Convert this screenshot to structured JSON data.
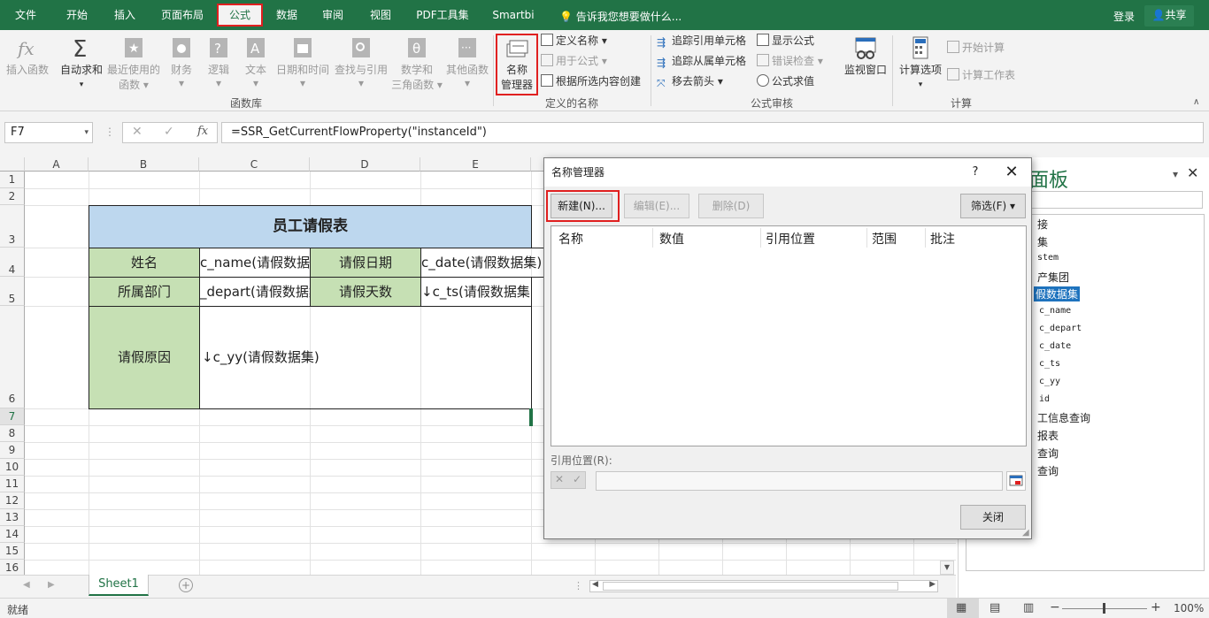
{
  "menu": {
    "tabs": [
      "文件",
      "开始",
      "插入",
      "页面布局",
      "公式",
      "数据",
      "审阅",
      "视图",
      "PDF工具集",
      "Smartbi"
    ],
    "active_tab": "公式",
    "tell_me": "告诉我您想要做什么...",
    "login": "登录",
    "share": "共享"
  },
  "ribbon": {
    "function_library": {
      "label": "函数库",
      "insert_function": "插入函数",
      "autosum": "自动求和",
      "recent_1": "最近使用的",
      "recent_2": "函数",
      "financial": "财务",
      "logical": "逻辑",
      "text": "文本",
      "datetime": "日期和时间",
      "lookup": "查找与引用",
      "math_1": "数学和",
      "math_2": "三角函数",
      "other": "其他函数"
    },
    "defined_names": {
      "label": "定义的名称",
      "name_manager_1": "名称",
      "name_manager_2": "管理器",
      "define_name": "定义名称",
      "use_in_formula": "用于公式",
      "create_from_selection": "根据所选内容创建"
    },
    "formula_auditing": {
      "label": "公式审核",
      "trace_precedents": "追踪引用单元格",
      "trace_dependents": "追踪从属单元格",
      "remove_arrows": "移去箭头",
      "show_formulas": "显示公式",
      "error_checking": "错误检查",
      "evaluate_formula": "公式求值",
      "watch_window": "监视窗口"
    },
    "calculation": {
      "label": "计算",
      "calc_options": "计算选项",
      "calc_now": "开始计算",
      "calc_sheet": "计算工作表"
    }
  },
  "formula_bar": {
    "name_box": "F7",
    "formula": "=SSR_GetCurrentFlowProperty(\"instanceId\")",
    "fx": "fx"
  },
  "grid": {
    "columns": [
      "A",
      "B",
      "C",
      "D",
      "E"
    ],
    "rows": [
      "1",
      "2",
      "3",
      "4",
      "5",
      "6",
      "7",
      "8",
      "9",
      "10",
      "11",
      "12",
      "13",
      "14",
      "15",
      "16"
    ],
    "title": "员工请假表",
    "name_label": "姓名",
    "name_value": "c_name(请假数据集",
    "date_label": "请假日期",
    "date_value": "c_date(请假数据集)",
    "dept_label": "所属部门",
    "dept_value": "_depart(请假数据集",
    "days_label": "请假天数",
    "days_value": "↓c_ts(请假数据集)",
    "reason_label": "请假原因",
    "reason_value": "↓c_yy(请假数据集)"
  },
  "sheets": {
    "active": "Sheet1"
  },
  "status": {
    "mode": "就绪",
    "zoom": "100%"
  },
  "right_pane": {
    "title": "面板",
    "items": [
      "接",
      "集",
      "stem",
      "产集团",
      "假数据集",
      "c_name",
      "c_depart",
      "c_date",
      "c_ts",
      "c_yy",
      "id",
      "工信息查询",
      "报表",
      "查询",
      "查询"
    ]
  },
  "dialog": {
    "title": "名称管理器",
    "help": "?",
    "new_btn": "新建(N)...",
    "edit_btn": "编辑(E)...",
    "delete_btn": "删除(D)",
    "filter_btn": "筛选(F) ▾",
    "columns": [
      "名称",
      "数值",
      "引用位置",
      "范围",
      "批注"
    ],
    "ref_label": "引用位置(R):",
    "close_btn": "关闭"
  }
}
